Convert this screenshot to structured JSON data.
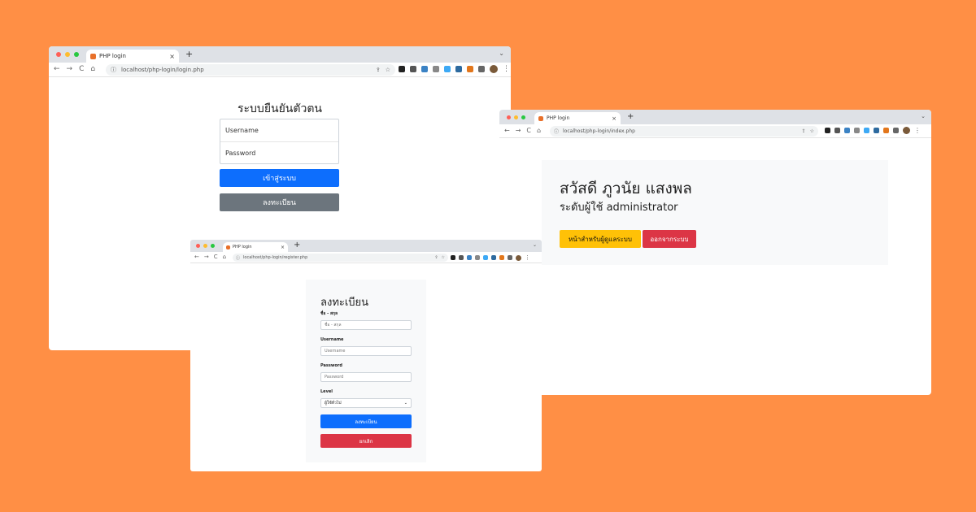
{
  "login_window": {
    "tab_title": "PHP login",
    "url": "localhost/php-login/login.php",
    "form": {
      "title": "ระบบยืนยันตัวตน",
      "username_placeholder": "Username",
      "password_placeholder": "Password",
      "submit_label": "เข้าสู่ระบบ",
      "register_label": "ลงทะเบียน"
    }
  },
  "register_window": {
    "tab_title": "PHP login",
    "url": "localhost/php-login/register.php",
    "form": {
      "title": "ลงทะเบียน",
      "fullname_label": "ชื่อ - สกุล",
      "fullname_placeholder": "ชื่อ - สกุล",
      "username_label": "Username",
      "username_placeholder": "Username",
      "password_label": "Password",
      "password_placeholder": "Password",
      "level_label": "Level",
      "level_selected": "ผู้ใช้ทั่วไป",
      "submit_label": "ลงทะเบียน",
      "cancel_label": "ยกเลิก"
    }
  },
  "index_window": {
    "tab_title": "PHP login",
    "url": "localhost/php-login/index.php",
    "greeting": "สวัสดี ภูวนัย แสงพล",
    "level_text": "ระดับผู้ใช้ administrator",
    "admin_button": "หน้าสำหรับผู้ดูแลระบบ",
    "logout_button": "ออกจากระบบ"
  },
  "browser": {
    "back_icon": "←",
    "forward_icon": "→",
    "reload_icon": "C",
    "home_icon": "⌂",
    "new_tab_icon": "+",
    "close_tab_icon": "×",
    "tab_menu_icon": "⌄",
    "info_icon": "ⓘ",
    "star_icon": "☆",
    "share_icon": "⇪",
    "menu_icon": "⋮",
    "select_chevron": "⌄"
  },
  "colors": {
    "background": "#FF8F45",
    "primary": "#0d6efd",
    "secondary": "#6c757d",
    "danger": "#dc3545",
    "warning": "#ffc107"
  }
}
